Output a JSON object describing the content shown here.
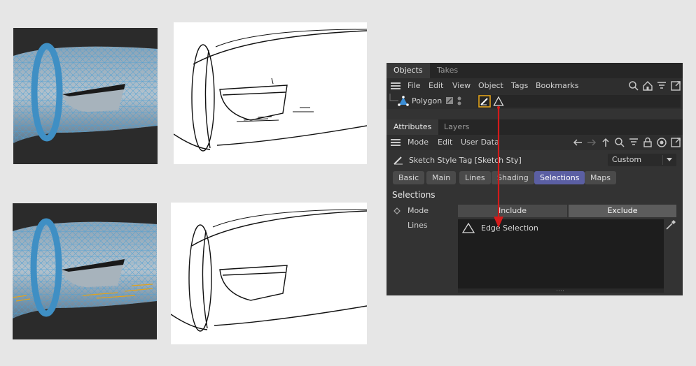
{
  "objects_panel": {
    "tabs": [
      "Objects",
      "Takes"
    ],
    "menu": [
      "File",
      "Edit",
      "View",
      "Object",
      "Tags",
      "Bookmarks"
    ],
    "object_name": "Polygon"
  },
  "attributes_panel": {
    "tabs": [
      "Attributes",
      "Layers"
    ],
    "menu": [
      "Mode",
      "Edit",
      "User Data"
    ],
    "tag_title": "Sketch Style Tag [Sketch Sty]",
    "preset": "Custom",
    "section_tabs": [
      "Basic",
      "Main",
      "Lines",
      "Shading",
      "Selections",
      "Maps"
    ],
    "active_tab": "Selections",
    "section_title": "Selections",
    "mode_label": "Mode",
    "mode_options": [
      "Include",
      "Exclude"
    ],
    "mode_selected": "Exclude",
    "lines_label": "Lines",
    "lines_items": [
      "Edge Selection"
    ]
  },
  "colors": {
    "accent_tab": "#5b5fa3",
    "highlight_orange": "#e2a21a",
    "arrow_red": "#d41a1a",
    "wire_blue": "#4a9fd4"
  }
}
